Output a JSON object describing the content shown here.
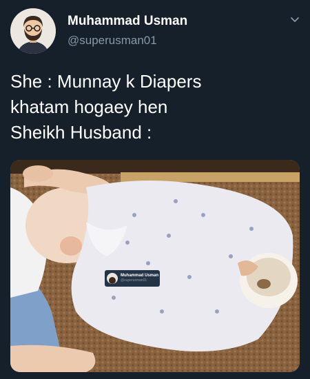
{
  "author": {
    "name": "Muhammad Usman",
    "handle": "@superusman01",
    "avatar_icon": "avatar-cartoon-man-glasses-beard"
  },
  "menu_icon": "chevron-down-icon",
  "tweet": {
    "lines": [
      "She : Munnay k Diapers",
      "khatam hogaey hen",
      "Sheikh Husband :"
    ]
  },
  "media": {
    "description_icon": "photo-baby-sleeping-with-cup",
    "watermark": {
      "name": "Muhammad Usman",
      "handle": "@superusman01"
    }
  },
  "colors": {
    "background": "#15202b",
    "text_primary": "#ffffff",
    "text_secondary": "#8899a6"
  }
}
